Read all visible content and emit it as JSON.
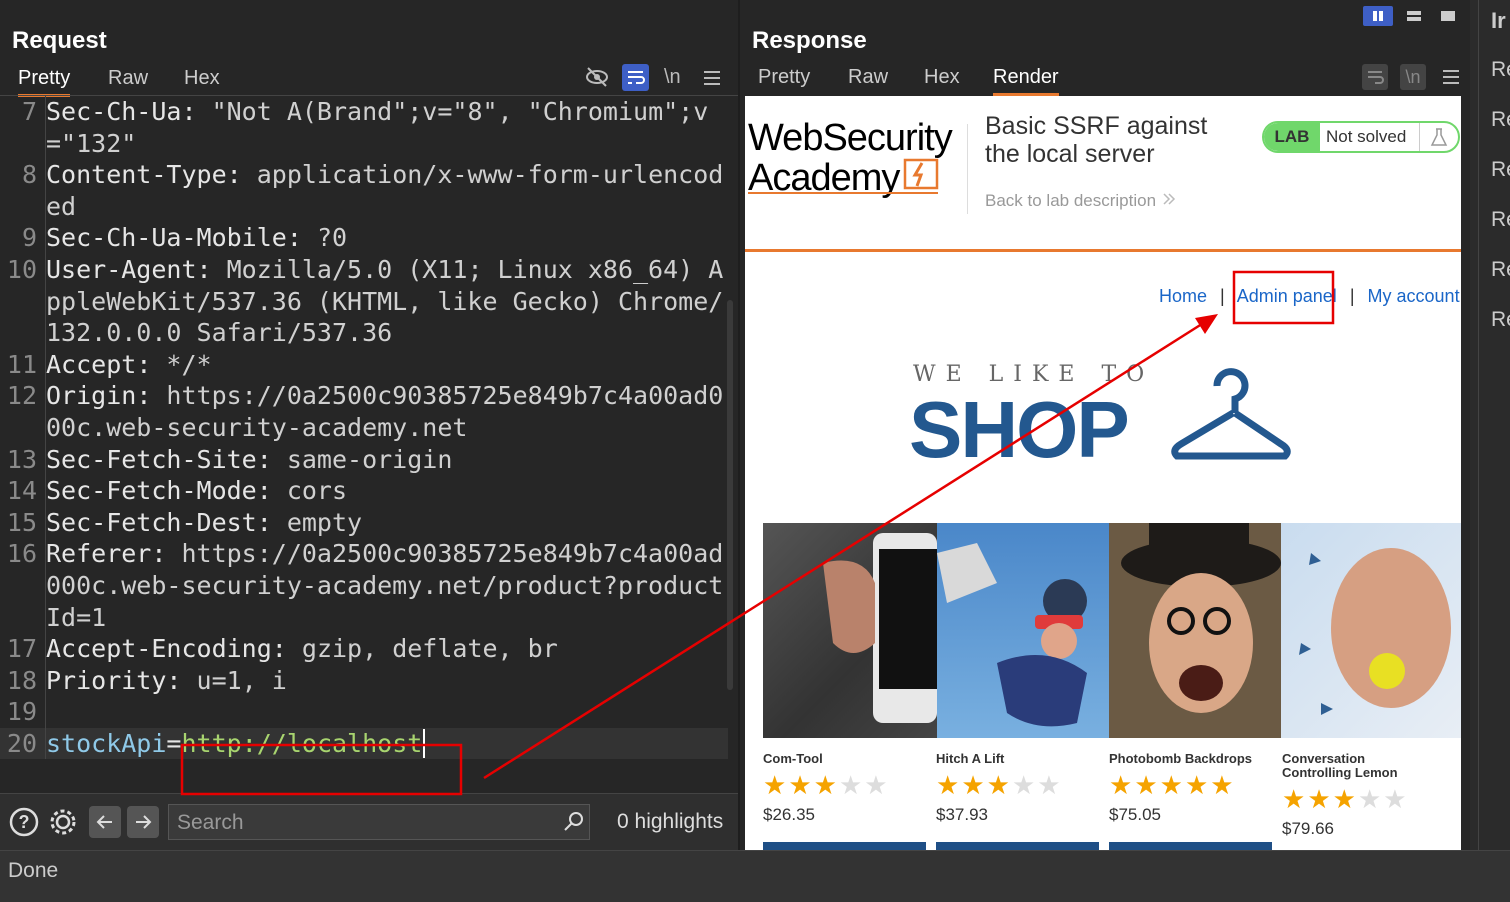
{
  "request": {
    "title": "Request",
    "tabs": [
      "Pretty",
      "Raw",
      "Hex"
    ],
    "lines": [
      {
        "n": "7",
        "name": "Sec-Ch-Ua",
        "sep": ": ",
        "value": "\"Not A(Brand\";v=\"8\", \"Chromium\";v=\"132\""
      },
      {
        "n": "8",
        "name": "Content-Type",
        "sep": ": ",
        "value": "application/x-www-form-urlencoded"
      },
      {
        "n": "9",
        "name": "Sec-Ch-Ua-Mobile",
        "sep": ": ",
        "value": "?0"
      },
      {
        "n": "10",
        "name": "User-Agent",
        "sep": ": ",
        "value": "Mozilla/5.0 (X11; Linux x86_64) AppleWebKit/537.36 (KHTML, like Gecko) Chrome/132.0.0.0 Safari/537.36"
      },
      {
        "n": "11",
        "name": "Accept",
        "sep": ": ",
        "value": "*/*"
      },
      {
        "n": "12",
        "name": "Origin",
        "sep": ": ",
        "value": "https://0a2500c90385725e849b7c4a00ad000c.web-security-academy.net"
      },
      {
        "n": "13",
        "name": "Sec-Fetch-Site",
        "sep": ": ",
        "value": "same-origin"
      },
      {
        "n": "14",
        "name": "Sec-Fetch-Mode",
        "sep": ": ",
        "value": "cors"
      },
      {
        "n": "15",
        "name": "Sec-Fetch-Dest",
        "sep": ": ",
        "value": "empty"
      },
      {
        "n": "16",
        "name": "Referer",
        "sep": ": ",
        "value": "https://0a2500c90385725e849b7c4a00ad000c.web-security-academy.net/product?productId=1"
      },
      {
        "n": "17",
        "name": "Accept-Encoding",
        "sep": ": ",
        "value": "gzip, deflate, br"
      },
      {
        "n": "18",
        "name": "Priority",
        "sep": ": ",
        "value": "u=1, i"
      },
      {
        "n": "19",
        "name": "",
        "sep": "",
        "value": ""
      }
    ],
    "body_line": {
      "n": "20",
      "param": "stockApi",
      "eq": "=",
      "value": "http://localhost"
    },
    "newline_label": "\\n",
    "search_placeholder": "Search",
    "highlights": "0 highlights"
  },
  "response": {
    "title": "Response",
    "tabs": [
      "Pretty",
      "Raw",
      "Hex",
      "Render"
    ],
    "newline_label": "\\n"
  },
  "page": {
    "logo_line1": "WebSecurity",
    "logo_line2": "Academy",
    "lab_title": "Basic SSRF against the local server",
    "back_link": "Back to lab description",
    "lab_badge": "LAB",
    "lab_status": "Not solved",
    "nav": {
      "home": "Home",
      "admin": "Admin panel",
      "account": "My account",
      "sep": "|"
    },
    "banner_small": "WE LIKE TO",
    "banner_big": "SHOP",
    "products": [
      {
        "name": "Com-Tool",
        "stars": 3,
        "price": "$26.35"
      },
      {
        "name": "Hitch A Lift",
        "stars": 3,
        "price": "$37.93"
      },
      {
        "name": "Photobomb Backdrops",
        "stars": 5,
        "price": "$75.05"
      },
      {
        "name": "Conversation Controlling Lemon",
        "stars": 3,
        "price": "$79.66"
      }
    ]
  },
  "status": "Done",
  "right_strip": [
    "Ir",
    "Re",
    "Re",
    "Re",
    "Re",
    "Re",
    "Re"
  ],
  "colors": {
    "accent": "#e8792f",
    "annotation": "#e60000",
    "link": "#1a66c8",
    "star": "#f5a300"
  }
}
